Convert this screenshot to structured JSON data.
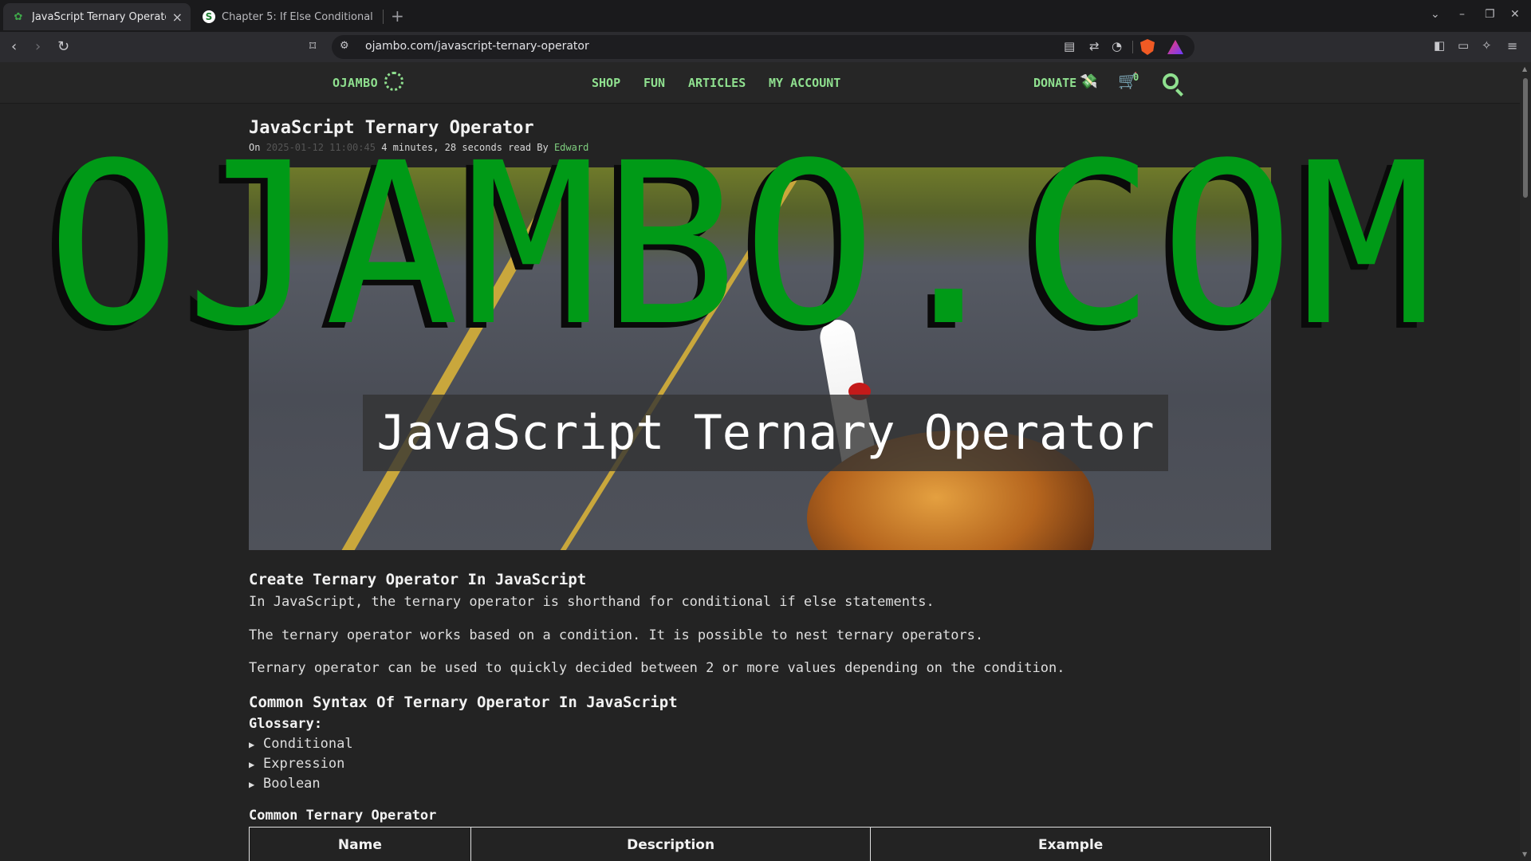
{
  "browser": {
    "tabs": [
      {
        "label": "JavaScript Ternary Operator",
        "active": true
      },
      {
        "label": "Chapter 5: If Else Conditional S",
        "active": false
      }
    ],
    "url": "ojambo.com/javascript-ternary-operator"
  },
  "site": {
    "brand": "OJAMBO",
    "nav": [
      "SHOP",
      "FUN",
      "ARTICLES",
      "MY ACCOUNT"
    ],
    "donate": "DONATE",
    "cart_count": "0"
  },
  "article": {
    "title": "JavaScript Ternary Operator",
    "meta_prefix": "On",
    "meta_date": "2025-01-12 11:00:45",
    "meta_read": "4 minutes, 28 seconds read By",
    "meta_author": "Edward",
    "hero_caption": "JavaScript Ternary Operator",
    "section1_heading": "Create Ternary Operator In JavaScript",
    "para1": "In JavaScript, the ternary operator is shorthand for conditional if else statements.",
    "para2": "The ternary operator works based on a condition. It is possible to nest ternary operators.",
    "para3": "Ternary operator can be used to quickly decided between 2 or more values depending on the condition.",
    "section2_heading": "Common Syntax Of Ternary Operator In JavaScript",
    "glossary_label": "Glossary:",
    "glossary": [
      "Conditional",
      "Expression",
      "Boolean"
    ],
    "table_caption": "Common Ternary Operator",
    "table_headers": [
      "Name",
      "Description",
      "Example"
    ]
  },
  "watermark": "OJAMBO.COM",
  "colors": {
    "accent": "#8fe08f",
    "watermark": "#009a17",
    "background": "#232323"
  }
}
